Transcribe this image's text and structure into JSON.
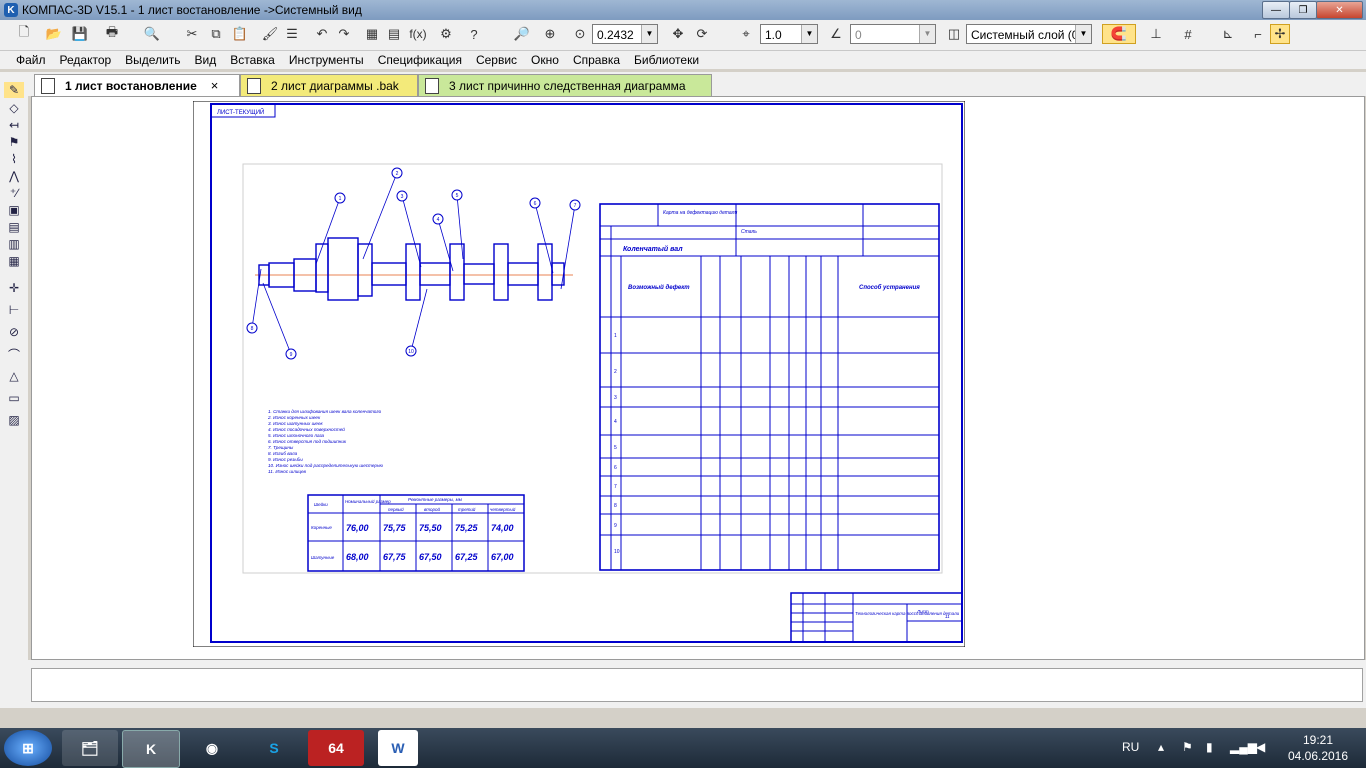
{
  "window": {
    "title": "КОМПАС-3D V15.1 - 1 лист востановление  ->Системный вид",
    "app_icon": "K"
  },
  "toolbar": {
    "zoom_value": "0.2432",
    "step_value": "1.0",
    "angle_value": "0",
    "layer_value": "Системный слой (0)",
    "fx_label": "f(x)"
  },
  "menu": [
    "Файл",
    "Редактор",
    "Выделить",
    "Вид",
    "Вставка",
    "Инструменты",
    "Спецификация",
    "Сервис",
    "Окно",
    "Справка",
    "Библиотеки"
  ],
  "tabs": [
    {
      "label": "1 лист востановление",
      "close": "×"
    },
    {
      "label": "2 лист диаграммы  .bak"
    },
    {
      "label": "3 лист причинно следственная диаграмма"
    }
  ],
  "drawing": {
    "stamp_top": "ЛИСТ-ТЕКУЩИЙ",
    "detail_numbers": [
      "1",
      "2",
      "3",
      "4",
      "5",
      "6",
      "7",
      "8",
      "9",
      "10",
      "11"
    ],
    "conditions": [
      "1. Станки для шлифования шеек вала коленчатого",
      "2. Износ коренных шеек",
      "3. Износ шатунных шеек",
      "4. Износ посадочных поверхностей",
      "5. Износ шпоночного паза",
      "6. Износ отверстия под подшипник",
      "7. Трещины",
      "8. Изгиб вала",
      "9. Износ резьбы",
      "10. Износ шейки под распределительную шестерню",
      "11. Износ шлицев"
    ],
    "size_table": {
      "headers": [
        "Шейки",
        "Номинальный размер",
        "Ремонтные размеры, мм",
        "первый",
        "второй",
        "третий",
        "четвертый"
      ],
      "rows": [
        {
          "name": "Коренные",
          "values": [
            "76,00",
            "75,75",
            "75,50",
            "75,25",
            "74,00"
          ]
        },
        {
          "name": "Шатунные",
          "values": [
            "68,00",
            "67,75",
            "67,50",
            "67,25",
            "67,00"
          ]
        }
      ]
    },
    "map_table": {
      "header_title": "Карта на дефектацию детали",
      "part_name": "Коленчатый вал",
      "material": "Сталь",
      "col_defect": "Возможный дефект",
      "col_method": "Способ устранения",
      "defect_rows": [
        "1",
        "2",
        "3",
        "4",
        "5",
        "6",
        "7",
        "8",
        "9",
        "10"
      ]
    },
    "title_block": {
      "name": "Технологическая карта восстановления детали",
      "sheet": "Лист",
      "sheets": "11"
    }
  },
  "taskbar": {
    "lang": "RU",
    "time": "19:21",
    "date": "04.06.2016",
    "apps": [
      "start-orb",
      "explorer",
      "kompas",
      "chrome",
      "skype",
      "aida64",
      "word"
    ]
  }
}
